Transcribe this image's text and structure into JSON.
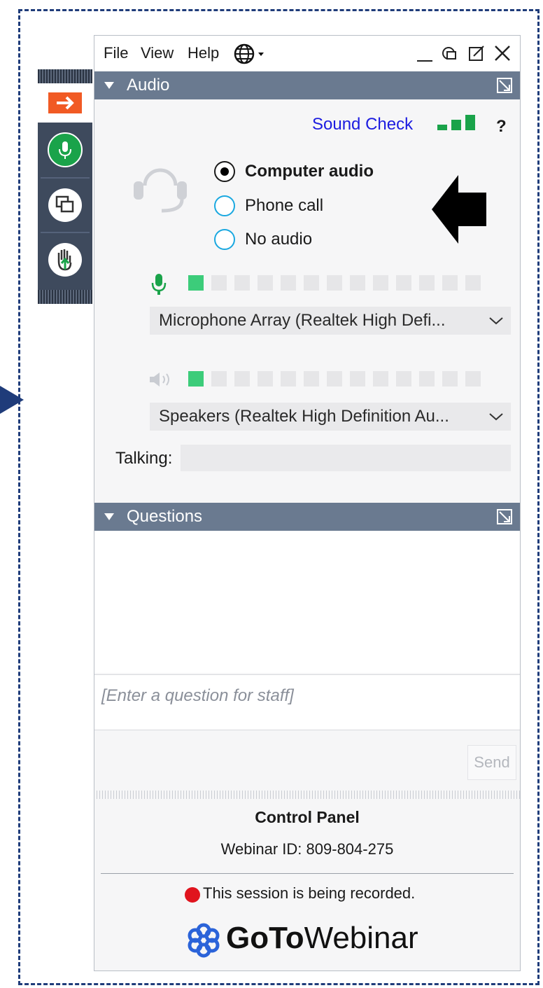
{
  "menu": {
    "file": "File",
    "view": "View",
    "help": "Help"
  },
  "audio": {
    "section_title": "Audio",
    "sound_check": "Sound Check",
    "help_icon": "?",
    "options": [
      {
        "label": "Computer audio",
        "selected": true
      },
      {
        "label": "Phone call",
        "selected": false
      },
      {
        "label": "No audio",
        "selected": false
      }
    ],
    "microphone_level": 1,
    "speaker_level": 1,
    "meter_segments": 13,
    "microphone_device": "Microphone Array (Realtek High Defi...",
    "speaker_device": "Speakers (Realtek High Definition Au...",
    "talking_label": "Talking:"
  },
  "questions": {
    "section_title": "Questions",
    "placeholder": "[Enter a question for staff]",
    "send_label": "Send"
  },
  "footer": {
    "title": "Control Panel",
    "webinar_id": "Webinar ID: 809-804-275",
    "recording_notice": "This session is being recorded.",
    "logo_bold": "GoTo",
    "logo_regular": "Webinar"
  },
  "colors": {
    "header": "#6a7a90",
    "accent_green": "#1aa34a",
    "link": "#1c1ce0",
    "record": "#e0141e"
  }
}
